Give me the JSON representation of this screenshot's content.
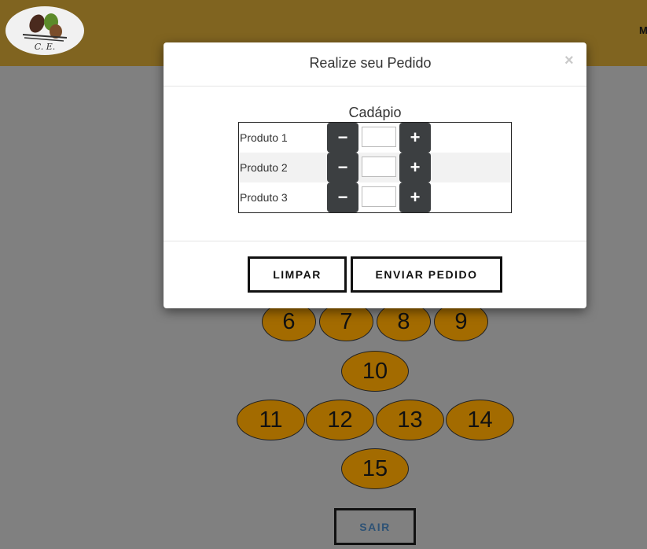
{
  "header": {
    "logo_text": "C. E.",
    "nav_link": "M"
  },
  "modal": {
    "title": "Realize seu Pedido",
    "close": "×",
    "menu_title": "Cadápio",
    "products": [
      {
        "name": "Produto 1",
        "quantity": ""
      },
      {
        "name": "Produto 2",
        "quantity": ""
      },
      {
        "name": "Produto 3",
        "quantity": ""
      }
    ],
    "minus_label": "−",
    "plus_label": "+",
    "clear_label": "LIMPAR",
    "send_label": "ENVIAR PEDIDO"
  },
  "tables": [
    "6",
    "7",
    "8",
    "9",
    "10",
    "11",
    "12",
    "13",
    "14",
    "15"
  ],
  "exit_label": "SAIR",
  "colors": {
    "header": "#806420",
    "table": "#a36b00",
    "background": "#808080",
    "qty_button": "#3c3f41",
    "exit_text": "#2e5275"
  }
}
